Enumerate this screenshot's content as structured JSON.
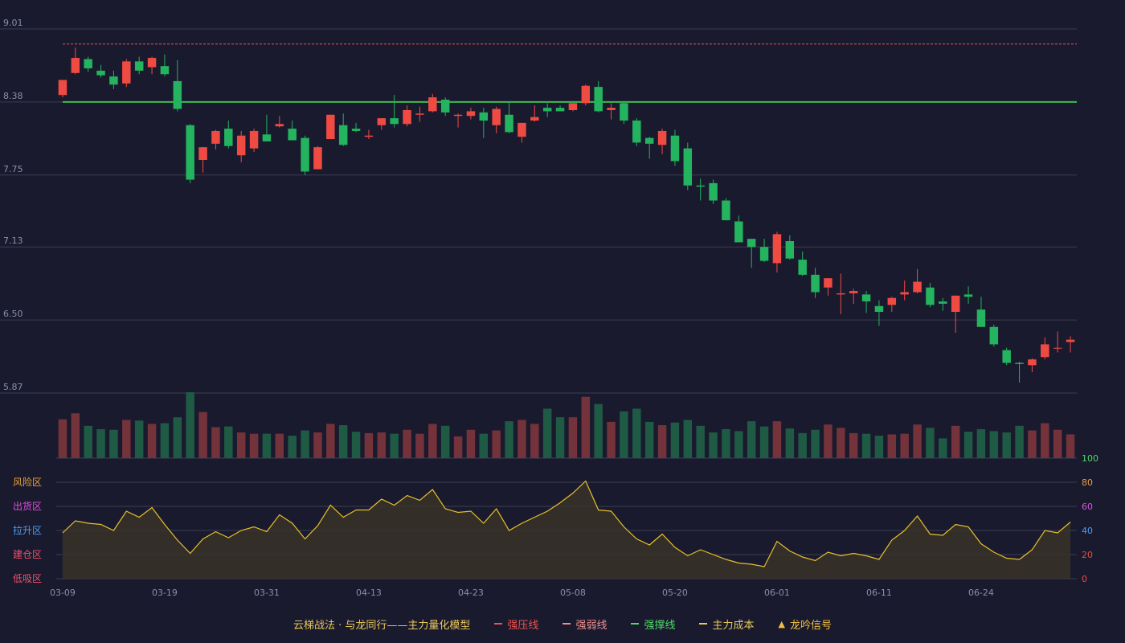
{
  "chart_data": {
    "type": "candlestick",
    "x_tick_labels": [
      "03-09",
      "03-19",
      "03-31",
      "04-13",
      "04-23",
      "05-08",
      "05-20",
      "06-01",
      "06-11",
      "06-24"
    ],
    "y_ticks": [
      "9.01",
      "8.38",
      "7.75",
      "7.13",
      "6.50",
      "5.87"
    ],
    "ylim": [
      5.87,
      9.01
    ],
    "ohlc": [
      [
        8.44,
        8.57,
        8.42,
        8.57
      ],
      [
        8.63,
        8.85,
        8.62,
        8.76
      ],
      [
        8.75,
        8.77,
        8.64,
        8.67
      ],
      [
        8.65,
        8.7,
        8.59,
        8.61
      ],
      [
        8.6,
        8.65,
        8.49,
        8.53
      ],
      [
        8.54,
        8.75,
        8.51,
        8.73
      ],
      [
        8.73,
        8.77,
        8.62,
        8.65
      ],
      [
        8.68,
        8.77,
        8.62,
        8.76
      ],
      [
        8.69,
        8.79,
        8.6,
        8.62
      ],
      [
        8.56,
        8.74,
        8.3,
        8.32
      ],
      [
        8.18,
        8.19,
        7.68,
        7.71
      ],
      [
        7.88,
        7.99,
        7.77,
        7.99
      ],
      [
        8.02,
        8.14,
        7.97,
        8.13
      ],
      [
        8.15,
        8.22,
        7.98,
        8.0
      ],
      [
        7.92,
        8.13,
        7.86,
        8.09
      ],
      [
        7.98,
        8.15,
        7.95,
        8.13
      ],
      [
        8.1,
        8.27,
        8.04,
        8.04
      ],
      [
        8.17,
        8.26,
        8.16,
        8.19
      ],
      [
        8.15,
        8.22,
        8.05,
        8.05
      ],
      [
        8.07,
        8.09,
        7.75,
        7.78
      ],
      [
        7.8,
        8.0,
        7.8,
        7.99
      ],
      [
        8.06,
        8.27,
        8.06,
        8.27
      ],
      [
        8.18,
        8.28,
        8.0,
        8.01
      ],
      [
        8.15,
        8.2,
        8.12,
        8.13
      ],
      [
        8.08,
        8.14,
        8.06,
        8.09
      ],
      [
        8.18,
        8.24,
        8.14,
        8.24
      ],
      [
        8.24,
        8.44,
        8.16,
        8.19
      ],
      [
        8.19,
        8.35,
        8.17,
        8.31
      ],
      [
        8.27,
        8.34,
        8.21,
        8.28
      ],
      [
        8.3,
        8.45,
        8.29,
        8.42
      ],
      [
        8.4,
        8.42,
        8.26,
        8.29
      ],
      [
        8.26,
        8.28,
        8.16,
        8.27
      ],
      [
        8.26,
        8.33,
        8.23,
        8.3
      ],
      [
        8.29,
        8.33,
        8.07,
        8.22
      ],
      [
        8.18,
        8.34,
        8.11,
        8.32
      ],
      [
        8.27,
        8.38,
        8.11,
        8.12
      ],
      [
        8.08,
        8.2,
        8.03,
        8.2
      ],
      [
        8.22,
        8.35,
        8.21,
        8.25
      ],
      [
        8.33,
        8.37,
        8.25,
        8.3
      ],
      [
        8.33,
        8.35,
        8.3,
        8.3
      ],
      [
        8.31,
        8.37,
        8.3,
        8.37
      ],
      [
        8.37,
        8.53,
        8.35,
        8.52
      ],
      [
        8.51,
        8.56,
        8.29,
        8.3
      ],
      [
        8.31,
        8.37,
        8.23,
        8.33
      ],
      [
        8.37,
        8.38,
        8.19,
        8.22
      ],
      [
        8.22,
        8.24,
        8.0,
        8.03
      ],
      [
        8.07,
        8.08,
        7.89,
        8.02
      ],
      [
        8.01,
        8.15,
        7.93,
        8.13
      ],
      [
        8.09,
        8.14,
        7.83,
        7.87
      ],
      [
        7.98,
        8.03,
        7.62,
        7.66
      ],
      [
        7.66,
        7.72,
        7.53,
        7.65
      ],
      [
        7.68,
        7.71,
        7.5,
        7.53
      ],
      [
        7.53,
        7.55,
        7.36,
        7.36
      ],
      [
        7.35,
        7.4,
        7.17,
        7.17
      ],
      [
        7.2,
        7.2,
        6.95,
        7.13
      ],
      [
        7.13,
        7.2,
        7.0,
        7.01
      ],
      [
        6.99,
        7.26,
        6.91,
        7.24
      ],
      [
        7.18,
        7.23,
        7.02,
        7.03
      ],
      [
        7.02,
        7.09,
        6.88,
        6.89
      ],
      [
        6.89,
        6.95,
        6.69,
        6.74
      ],
      [
        6.78,
        6.86,
        6.71,
        6.86
      ],
      [
        6.72,
        6.9,
        6.55,
        6.73
      ],
      [
        6.73,
        6.77,
        6.64,
        6.75
      ],
      [
        6.72,
        6.75,
        6.56,
        6.66
      ],
      [
        6.62,
        6.67,
        6.45,
        6.57
      ],
      [
        6.63,
        6.7,
        6.57,
        6.69
      ],
      [
        6.72,
        6.84,
        6.67,
        6.74
      ],
      [
        6.74,
        6.94,
        6.73,
        6.83
      ],
      [
        6.78,
        6.82,
        6.61,
        6.63
      ],
      [
        6.66,
        6.69,
        6.58,
        6.64
      ],
      [
        6.57,
        6.71,
        6.39,
        6.71
      ],
      [
        6.72,
        6.79,
        6.64,
        6.7
      ],
      [
        6.59,
        6.7,
        6.44,
        6.44
      ],
      [
        6.44,
        6.46,
        6.27,
        6.29
      ],
      [
        6.24,
        6.26,
        6.11,
        6.13
      ],
      [
        6.13,
        6.14,
        5.96,
        6.12
      ],
      [
        6.11,
        6.17,
        6.05,
        6.16
      ],
      [
        6.18,
        6.35,
        6.16,
        6.29
      ],
      [
        6.26,
        6.4,
        6.22,
        6.26
      ],
      [
        6.31,
        6.36,
        6.22,
        6.33
      ]
    ],
    "volume_height_fraction": [
      0.59,
      0.68,
      0.49,
      0.44,
      0.43,
      0.58,
      0.57,
      0.52,
      0.53,
      0.62,
      1.0,
      0.7,
      0.47,
      0.48,
      0.39,
      0.37,
      0.37,
      0.37,
      0.34,
      0.42,
      0.39,
      0.52,
      0.5,
      0.4,
      0.38,
      0.39,
      0.37,
      0.43,
      0.37,
      0.52,
      0.49,
      0.33,
      0.43,
      0.37,
      0.42,
      0.56,
      0.58,
      0.52,
      0.75,
      0.62,
      0.62,
      0.93,
      0.82,
      0.55,
      0.71,
      0.75,
      0.55,
      0.5,
      0.54,
      0.58,
      0.49,
      0.39,
      0.44,
      0.41,
      0.56,
      0.48,
      0.56,
      0.45,
      0.38,
      0.43,
      0.51,
      0.46,
      0.38,
      0.37,
      0.34,
      0.36,
      0.37,
      0.51,
      0.46,
      0.3,
      0.49,
      0.4,
      0.44,
      0.41,
      0.39,
      0.49,
      0.42,
      0.53,
      0.43,
      0.36
    ],
    "resistance_level": 8.88,
    "support_level": 8.38,
    "oscillator": {
      "y_ticks": [
        0,
        20,
        40,
        60,
        80,
        100
      ],
      "ylim": [
        0,
        100
      ],
      "zone_labels": [
        "风险区",
        "出货区",
        "拉升区",
        "建仓区",
        "低吸区"
      ],
      "values": [
        38,
        48,
        46,
        45,
        40,
        56,
        51,
        59,
        45,
        32,
        21,
        33,
        39,
        34,
        40,
        43,
        39,
        53,
        46,
        33,
        44,
        61,
        51,
        57,
        57,
        66,
        61,
        69,
        65,
        74,
        58,
        55,
        56,
        46,
        58,
        40,
        46,
        51,
        56,
        63,
        71,
        81,
        57,
        56,
        43,
        33,
        28,
        37,
        26,
        19,
        24,
        20,
        16,
        13,
        12,
        10,
        31,
        23,
        18,
        15,
        22,
        19,
        21,
        19,
        16,
        32,
        40,
        52,
        37,
        36,
        45,
        43,
        29,
        22,
        17,
        16,
        24,
        40,
        38,
        47
      ]
    },
    "legend": [
      {
        "label": "强压线",
        "color": "#ef5350",
        "style": "solid"
      },
      {
        "label": "强弱线",
        "color": "#ef9090",
        "style": "dashed"
      },
      {
        "label": "强撑线",
        "color": "#4cd964",
        "style": "solid"
      },
      {
        "label": "主力成本",
        "color": "#e6c75a",
        "style": "dashed"
      },
      {
        "label": "龙吟信号",
        "color": "#f0c040",
        "style": "triangle"
      }
    ],
    "legend_title": "云梯战法 · 与龙同行——主力量化模型"
  },
  "colors": {
    "up": "#ef4b43",
    "down": "#24b35e",
    "grid": "#3a3d52",
    "axis_text": "#8a8fa8",
    "oscillator_line": "#e6c02a",
    "zone_1": "#e6a23c",
    "zone_2": "#e04fe0",
    "zone_3": "#4f9df0",
    "zone_4": "#f0506a",
    "zone_5": "#f0506a"
  }
}
